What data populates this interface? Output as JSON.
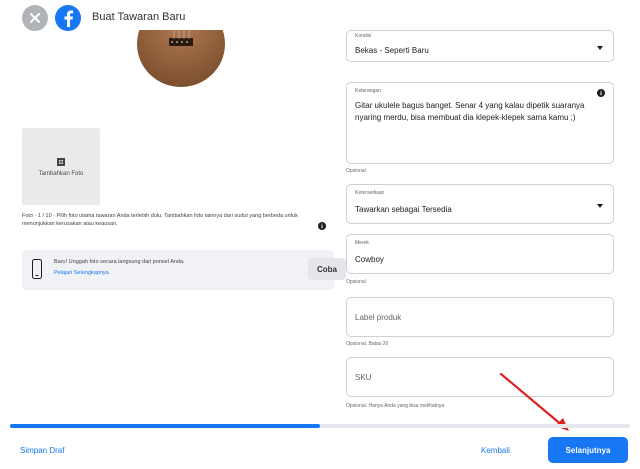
{
  "header": {
    "title": "Buat Tawaran Baru"
  },
  "left": {
    "add_photo_label": "Tambahkan Foto",
    "photo_info": "Foto · 1 / 10 · Pilih foto utama tawaran Anda terlebih dulu. Tambahkan foto lainnya dari sudut yang berbeda untuk menunjukkan kerusakan atau keausan.",
    "phone_text": "Baru! Unggah foto secara langsung dari ponsel Anda.",
    "phone_link": "Pelajari Selengkapnya",
    "try_button": "Coba"
  },
  "fields": {
    "condition": {
      "label": "Kondisi",
      "value": "Bekas - Seperti Baru"
    },
    "description": {
      "label": "Keterangan",
      "value": "Gitar ukulele bagus banget. Senar 4 yang kalau dipetik suaranya nyaring merdu, bisa membuat dia klepek-klepek sama kamu ;)"
    },
    "description_hint": "Opsional",
    "availability": {
      "label": "Ketersediaan",
      "value": "Tawarkan sebagai Tersedia"
    },
    "brand": {
      "label": "Merek",
      "value": "Cowboy"
    },
    "brand_hint": "Opsional",
    "product_tags": {
      "placeholder": "Label produk"
    },
    "product_tags_hint": "Opsional. Batas 20",
    "sku": {
      "placeholder": "SKU"
    },
    "sku_hint": "Opsional. Hanya Anda yang bisa melihatnya"
  },
  "footer": {
    "save_draft": "Simpan Draf",
    "back": "Kembali",
    "next": "Selanjutnya",
    "progress": 0.5
  },
  "colors": {
    "accent": "#1877f2",
    "annotation_arrow": "#e02020"
  }
}
